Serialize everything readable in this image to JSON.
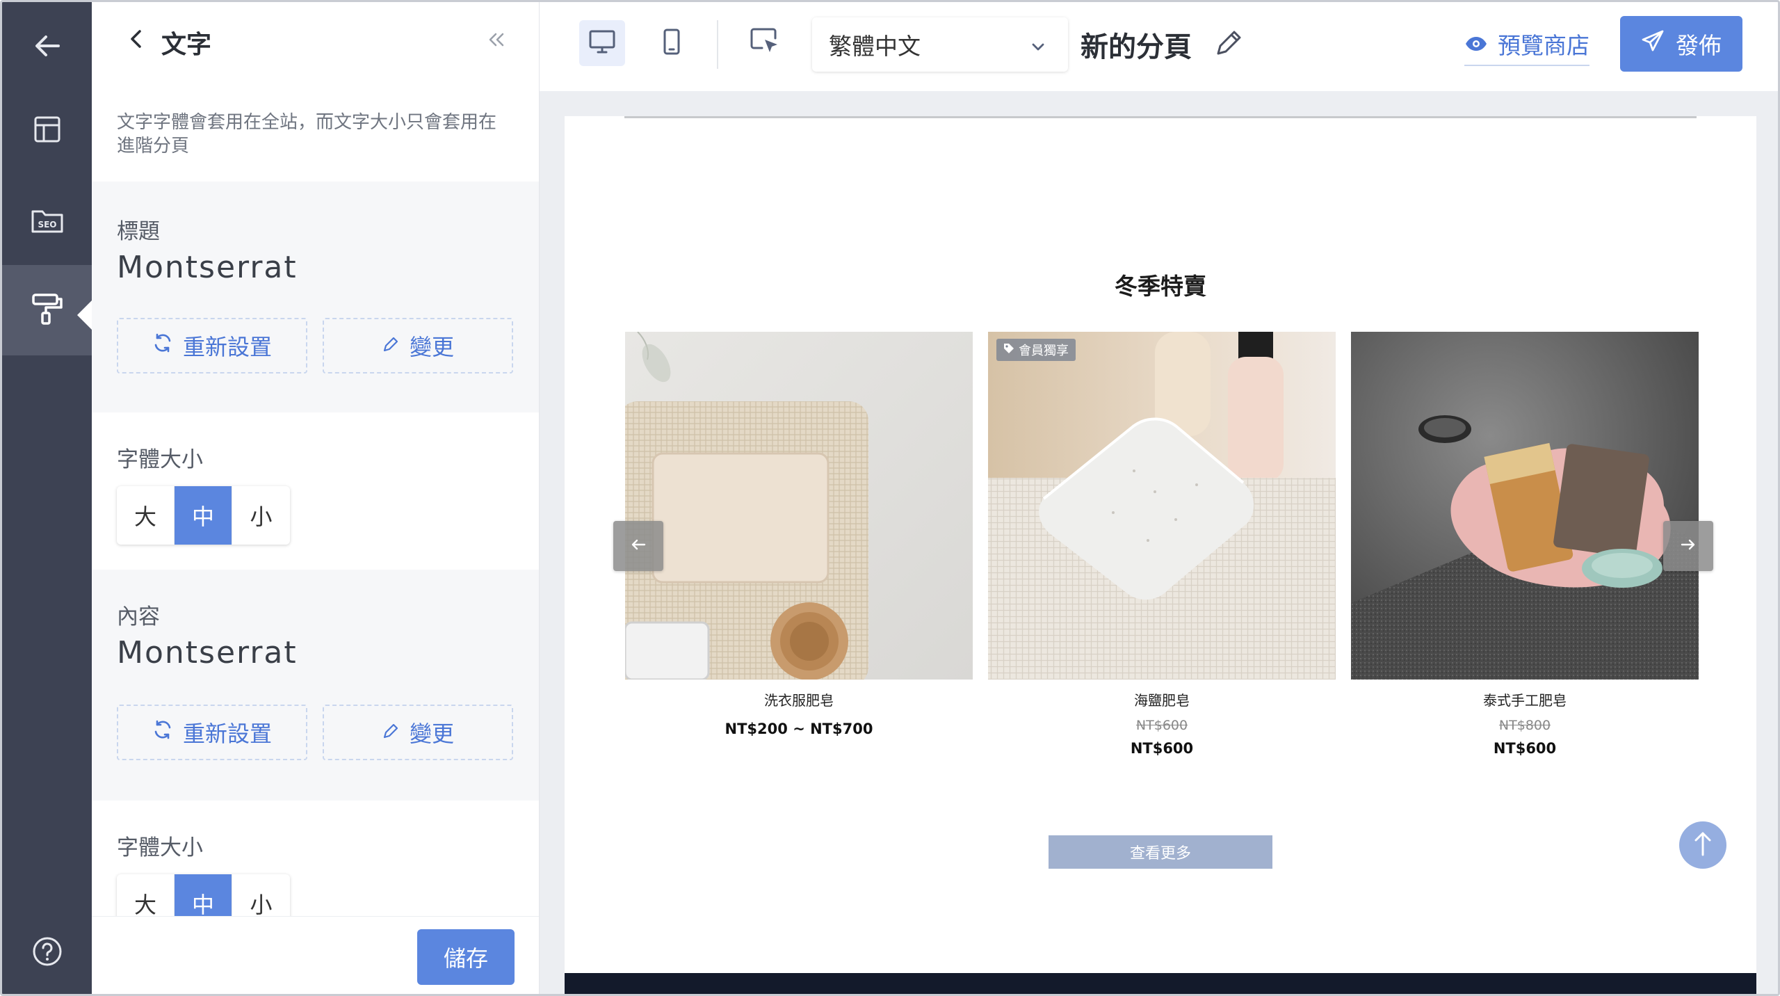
{
  "rail": {
    "items": [
      {
        "icon": "arrow-left-icon"
      },
      {
        "icon": "layout-icon"
      },
      {
        "icon": "seo-folder-icon",
        "text": "SEO"
      },
      {
        "icon": "paint-roller-icon"
      },
      {
        "icon": "help-circle-icon"
      }
    ]
  },
  "panel": {
    "title": "文字",
    "description": "文字字體會套用在全站，而文字大小只會套用在進階分頁",
    "heading": {
      "label": "標題",
      "font": "Montserrat",
      "reset_label": "重新設置",
      "change_label": "變更",
      "size_label": "字體大小",
      "sizes": [
        "大",
        "中",
        "小"
      ],
      "selected_size": "中"
    },
    "body": {
      "label": "內容",
      "font": "Montserrat",
      "reset_label": "重新設置",
      "change_label": "變更",
      "size_label": "字體大小",
      "sizes": [
        "大",
        "中",
        "小"
      ],
      "selected_size": "中"
    },
    "save_label": "儲存"
  },
  "topbar": {
    "language": "繁體中文",
    "page_name": "新的分頁",
    "preview_label": "預覽商店",
    "publish_label": "發佈",
    "accent": "#5b86df"
  },
  "canvas": {
    "section_title": "冬季特賣",
    "products": [
      {
        "name": "洗衣服肥皂",
        "old_price": "",
        "price": "NT$200 ~ NT$700",
        "badge": ""
      },
      {
        "name": "海鹽肥皂",
        "old_price": "NT$600",
        "price": "NT$600",
        "badge": "會員獨享"
      },
      {
        "name": "泰式手工肥皂",
        "old_price": "NT$800",
        "price": "NT$600",
        "badge": ""
      }
    ],
    "more_label": "查看更多"
  }
}
